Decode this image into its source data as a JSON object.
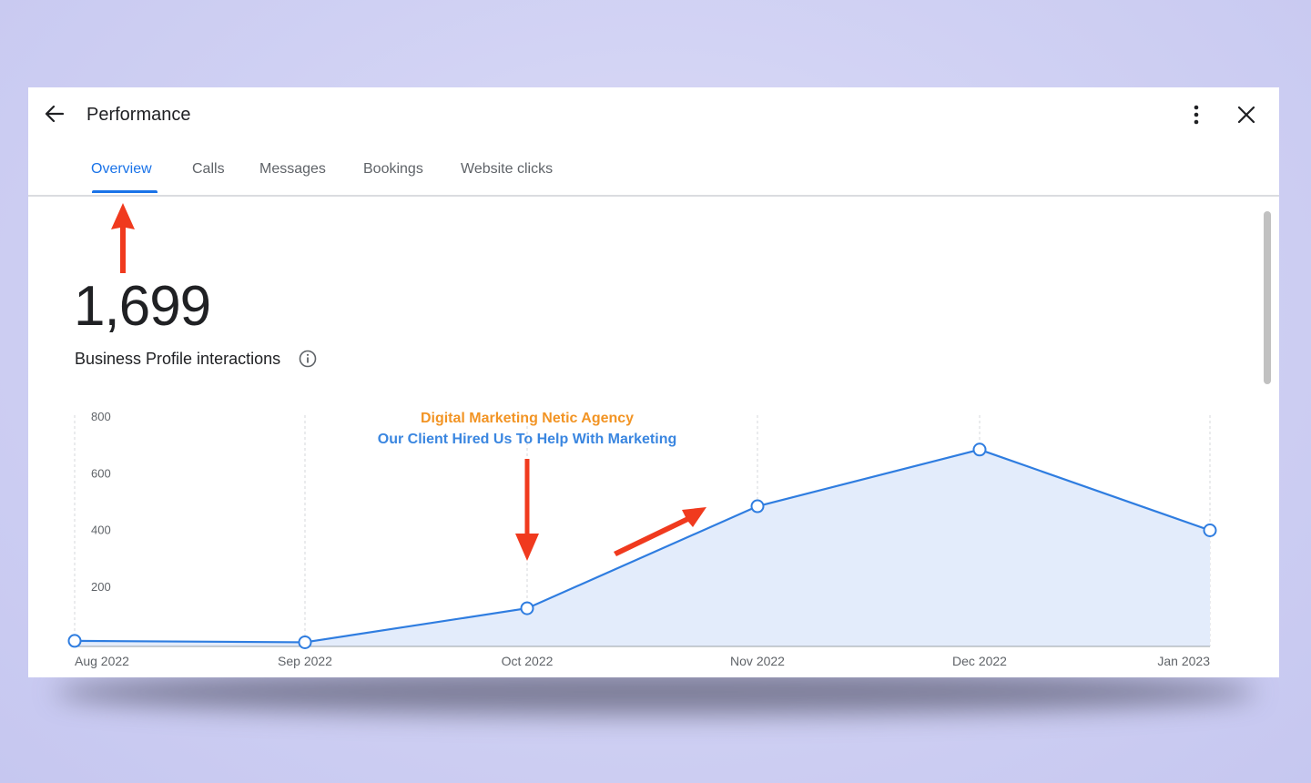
{
  "header": {
    "title": "Performance",
    "back_icon": "arrow-back-icon",
    "more_icon": "more-vert-icon",
    "close_icon": "close-icon"
  },
  "tabs": [
    {
      "label": "Overview",
      "active": true
    },
    {
      "label": "Calls",
      "active": false
    },
    {
      "label": "Messages",
      "active": false
    },
    {
      "label": "Bookings",
      "active": false
    },
    {
      "label": "Website clicks",
      "active": false
    }
  ],
  "summary": {
    "value": "1,699",
    "label": "Business Profile interactions",
    "info_icon": "info-icon"
  },
  "annotations": {
    "line1": "Digital Marketing Netic Agency",
    "line2": "Our Client Hired Us To Help With Marketing",
    "line1_color": "#f29424",
    "line2_color": "#3a86e0",
    "arrow_color": "#f03a1e"
  },
  "colors": {
    "accent": "#1a73e8",
    "line": "#2f7de0",
    "area": "#e3ecfb"
  },
  "chart_data": {
    "type": "area",
    "title": "",
    "xlabel": "",
    "ylabel": "",
    "categories": [
      "Aug 2022",
      "Sep 2022",
      "Oct 2022",
      "Nov 2022",
      "Dec 2022",
      "Jan 2023"
    ],
    "series": [
      {
        "values": [
          10,
          5,
          125,
          485,
          685,
          400
        ]
      }
    ],
    "yticks": [
      "200",
      "400",
      "600",
      "800"
    ],
    "ylim": [
      0,
      800
    ],
    "grid": "vertical-dashed"
  }
}
